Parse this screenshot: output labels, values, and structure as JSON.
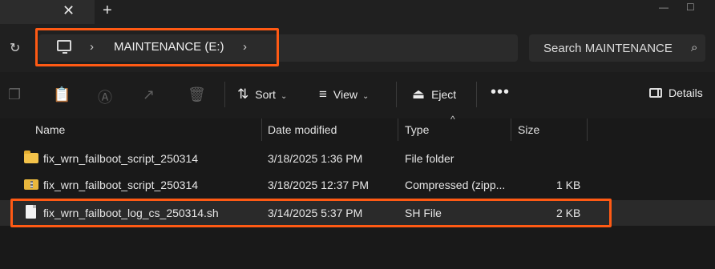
{
  "tabbar": {
    "close_glyph": "✕",
    "new_tab_glyph": "+"
  },
  "window_controls": {
    "minimize": "—",
    "maximize": "☐"
  },
  "navigation": {
    "refresh_glyph": "↻"
  },
  "address": {
    "separator": "›",
    "crumbs": [
      "MAINTENANCE (E:)"
    ]
  },
  "search": {
    "placeholder": "Search MAINTENANCE",
    "icon_glyph": "⌕"
  },
  "toolbar": {
    "sort_label": "Sort",
    "view_label": "View",
    "eject_label": "Eject",
    "more_glyph": "•••",
    "details_label": "Details",
    "chevron": "⌄"
  },
  "columns": {
    "name": "Name",
    "date_modified": "Date modified",
    "type": "Type",
    "size": "Size"
  },
  "files": [
    {
      "name": "fix_wrn_failboot_script_250314",
      "date": "3/18/2025 1:36 PM",
      "type": "File folder",
      "size": "",
      "icon": "folder-icon"
    },
    {
      "name": "fix_wrn_failboot_script_250314",
      "date": "3/18/2025 12:37 PM",
      "type": "Compressed (zipp...",
      "size": "1 KB",
      "icon": "zip-folder-icon"
    },
    {
      "name": "fix_wrn_failboot_log_cs_250314.sh",
      "date": "3/14/2025 5:37 PM",
      "type": "SH File",
      "size": "2 KB",
      "icon": "file-icon"
    }
  ],
  "colors": {
    "highlight": "#ff5a14",
    "background": "#191919",
    "bar": "#2b2b2b"
  }
}
